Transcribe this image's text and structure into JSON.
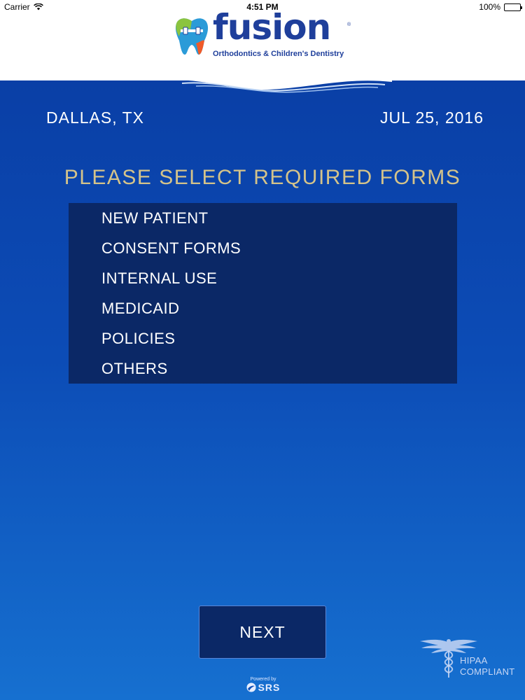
{
  "status_bar": {
    "carrier": "Carrier",
    "time": "4:51 PM",
    "battery": "100%",
    "icons": {
      "wifi": "wifi-icon",
      "battery": "battery-icon"
    }
  },
  "header": {
    "logo_word": "fusion",
    "logo_registered": "®",
    "logo_tagline": "Orthodontics & Children's Dentistry"
  },
  "info": {
    "location": "DALLAS, TX",
    "date": "JUL 25, 2016"
  },
  "forms": {
    "title": "PLEASE SELECT REQUIRED FORMS",
    "items": [
      {
        "label": "NEW PATIENT"
      },
      {
        "label": "CONSENT FORMS"
      },
      {
        "label": "INTERNAL USE"
      },
      {
        "label": "MEDICAID"
      },
      {
        "label": "POLICIES"
      },
      {
        "label": "OTHERS"
      }
    ]
  },
  "actions": {
    "next_label": "NEXT"
  },
  "footer": {
    "powered_by": "Powered by",
    "powered_brand": "SRS",
    "hipaa_line1": "HIPAA",
    "hipaa_line2": "COMPLIANT"
  },
  "colors": {
    "brand_blue": "#1f3f9b",
    "background_top": "#0a3fa6",
    "background_bottom": "#1670d0",
    "panel": "#0b2866",
    "title_gold": "#d4c38a",
    "text": "#ffffff"
  }
}
